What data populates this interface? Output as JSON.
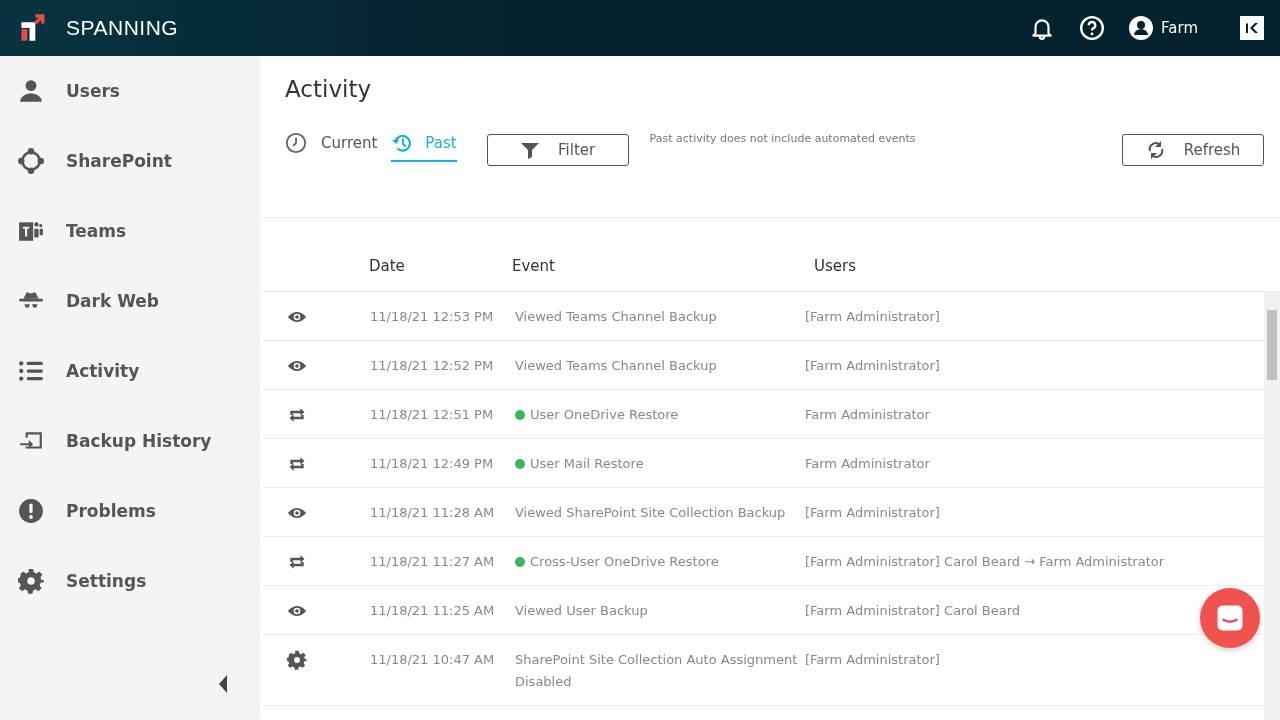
{
  "header": {
    "brand": "SPANNING",
    "user": "Farm"
  },
  "sidebar": {
    "items": [
      {
        "label": "Users",
        "kind": "user",
        "selected": false
      },
      {
        "label": "SharePoint",
        "kind": "sharepoint",
        "selected": false
      },
      {
        "label": "Teams",
        "kind": "teams",
        "selected": false
      },
      {
        "label": "Dark Web",
        "kind": "spy",
        "selected": false
      },
      {
        "label": "Activity",
        "kind": "list",
        "selected": false
      },
      {
        "label": "Backup History",
        "kind": "history",
        "selected": false
      },
      {
        "label": "Problems",
        "kind": "alert",
        "selected": false
      },
      {
        "label": "Settings",
        "kind": "gear",
        "selected": false
      }
    ]
  },
  "page": {
    "title": "Activity"
  },
  "tabs": [
    {
      "label": "Current",
      "kind": "clock",
      "selected": false
    },
    {
      "label": "Past",
      "kind": "history",
      "selected": true
    }
  ],
  "filter_button": "Filter",
  "note": "Past activity does not include automated events",
  "refresh_button": "Refresh",
  "table": {
    "columns": [
      "Date",
      "Event",
      "Users"
    ],
    "rows": [
      {
        "kind": "view",
        "date": "11/18/21 12:53 PM",
        "event": "Viewed Teams Channel Backup",
        "users": "[Farm Administrator]"
      },
      {
        "kind": "view",
        "date": "11/18/21 12:52 PM",
        "event": "Viewed Teams Channel Backup",
        "users": "[Farm Administrator]"
      },
      {
        "kind": "restore",
        "date": "11/18/21 12:51 PM",
        "event": "User OneDrive Restore",
        "users": "Farm Administrator",
        "color": "#3cb55e"
      },
      {
        "kind": "restore",
        "date": "11/18/21 12:49 PM",
        "event": "User Mail Restore",
        "users": "Farm Administrator",
        "color": "#3cb55e"
      },
      {
        "kind": "view",
        "date": "11/18/21 11:28 AM",
        "event": "Viewed SharePoint Site Collection Backup",
        "users": "[Farm Administrator]"
      },
      {
        "kind": "restore",
        "date": "11/18/21 11:27 AM",
        "event": "Cross-User OneDrive Restore",
        "users": "[Farm Administrator] Carol Beard → Farm Administrator",
        "color": "#3cb55e"
      },
      {
        "kind": "view",
        "date": "11/18/21 11:25 AM",
        "event": "Viewed User Backup",
        "users": "[Farm Administrator] Carol Beard"
      },
      {
        "kind": "setting",
        "date": "11/18/21 10:47 AM",
        "event": "SharePoint Site Collection Auto Assignment Disabled",
        "users": "[Farm Administrator]"
      }
    ]
  }
}
